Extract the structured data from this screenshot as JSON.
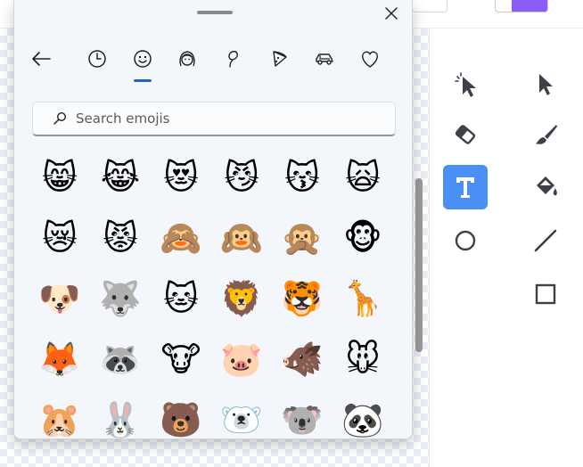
{
  "picker": {
    "search_placeholder": "Search emojis",
    "nav": [
      {
        "name": "back-arrow-icon"
      },
      {
        "name": "recent-clock-icon"
      },
      {
        "name": "smiley-face-icon"
      },
      {
        "name": "people-face-icon"
      },
      {
        "name": "nature-icon"
      },
      {
        "name": "food-pizza-icon"
      },
      {
        "name": "travel-car-icon"
      },
      {
        "name": "heart-symbols-icon"
      }
    ],
    "selected_tab": "smiley-face-icon",
    "emojis": [
      "😸",
      "😹",
      "😻",
      "😼",
      "😽",
      "🙀",
      "😿",
      "😾",
      "🙈",
      "🙉",
      "🙊",
      "🐵",
      "🐶",
      "🐺",
      "🐱",
      "🦁",
      "🐯",
      "🦒",
      "🦊",
      "🦝",
      "🐮",
      "🐷",
      "🐗",
      "🐭",
      "🐹",
      "🐰",
      "🐻",
      "🐻‍❄️",
      "🐨",
      "🐼"
    ]
  },
  "toolbar": {
    "tools": [
      {
        "name": "magic-select-cursor-icon"
      },
      {
        "name": "pointer-select-icon"
      },
      {
        "name": "eraser-icon"
      },
      {
        "name": "brush-icon"
      },
      {
        "name": "text-tool-icon",
        "active": true
      },
      {
        "name": "fill-bucket-icon"
      },
      {
        "name": "circle-shape-icon"
      },
      {
        "name": "line-shape-icon"
      },
      {
        "name": "square-shape-icon"
      }
    ],
    "active_color": "#4a8ff5",
    "secondary_color": "#8b5cf6"
  }
}
